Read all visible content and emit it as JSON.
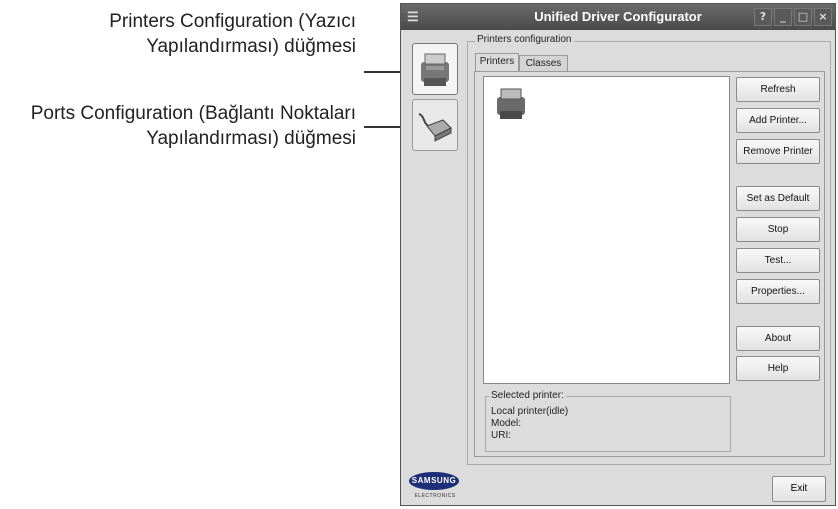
{
  "callouts": {
    "printers": [
      "Printers Configuration (Yazıcı",
      "Yapılandırması) düğmesi"
    ],
    "ports": [
      "Ports Configuration (Bağlantı Noktaları",
      "Yapılandırması) düğmesi"
    ]
  },
  "window": {
    "title": "Unified Driver Configurator",
    "controls": {
      "help": "?",
      "minimize": "_",
      "maximize": "□",
      "close": "×"
    }
  },
  "sidebar": {
    "items": [
      {
        "name": "printers-configuration",
        "icon": "printer-icon"
      },
      {
        "name": "ports-configuration",
        "icon": "port-cable-icon"
      }
    ]
  },
  "main": {
    "frame_label": "Printers configuration",
    "tabs": [
      {
        "label": "Printers"
      },
      {
        "label": "Classes"
      }
    ],
    "actions": {
      "refresh": "Refresh",
      "add_printer": "Add Printer...",
      "remove_printer": "Remove Printer",
      "set_default": "Set as Default",
      "stop": "Stop",
      "test": "Test...",
      "properties": "Properties...",
      "about": "About",
      "help": "Help"
    },
    "selected": {
      "label": "Selected printer:",
      "status": "Local printer(idle)",
      "model": "Model:",
      "uri": "URI:"
    }
  },
  "footer": {
    "logo": "SAMSUNG",
    "logo_sub": "ELECTRONICS",
    "exit": "Exit"
  },
  "colors": {
    "callout_dot": "#1f8a80",
    "logo": "#1e2f7a",
    "titlebar": "#555555"
  }
}
